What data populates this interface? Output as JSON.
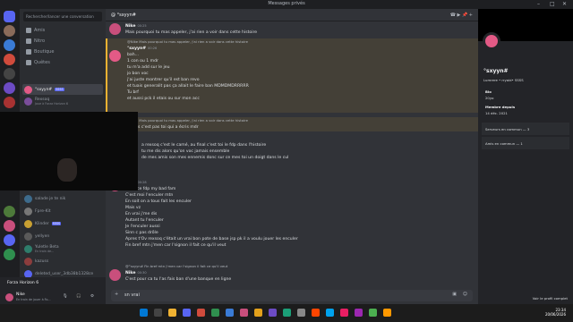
{
  "window": {
    "title": "Messages privés"
  },
  "sidebar": {
    "search_label": "Rechercher/lancer une conversation",
    "nav": [
      {
        "label": "Amis"
      },
      {
        "label": "Nitro"
      },
      {
        "label": "Boutique"
      },
      {
        "label": "Quêtes"
      }
    ],
    "section_title": "Messages privés",
    "dms": [
      {
        "name": "°sxyyn#",
        "tag": "SSSS",
        "sub": ""
      },
      {
        "name": "Rexsoq",
        "tag": "",
        "sub": "Joue à Forza Horizon 6"
      },
      {
        "name": "salade je te nik",
        "tag": "",
        "sub": ""
      },
      {
        "name": "Fpre-Kit",
        "tag": "",
        "sub": ""
      },
      {
        "name": "Klinder",
        "tag": "SSSS",
        "sub": ""
      },
      {
        "name": "yellyen",
        "tag": "",
        "sub": ""
      },
      {
        "name": "Yuletle Beta",
        "tag": "",
        "sub": "En train de..."
      },
      {
        "name": "kazuss",
        "tag": "",
        "sub": ""
      },
      {
        "name": "deleted_user_3db38b1328ce",
        "tag": "",
        "sub": ""
      }
    ],
    "game": "Forza Horizon 6",
    "user": {
      "name": "Nike",
      "status": "En train de jouer à Fo..."
    }
  },
  "chat": {
    "header_name": "°sxyyn#",
    "search_placeholder": "Rechercher à sxnnehe",
    "messages": [
      {
        "author": "Nike",
        "time": "00:25",
        "text": "Mais pourquoi tu mas appeler, j'ai rien a voir dans cette histoire",
        "reply": ""
      },
      {
        "author": "°sxyyn#",
        "time": "00:26",
        "text": "bah...",
        "reply": "@Nike Mais pourquoi tu mas appeler, j'ai rien a voir dans cette histoire"
      },
      {
        "author": "",
        "time": "",
        "text": "1 con ou 1 mdr",
        "reply": ""
      },
      {
        "author": "",
        "time": "",
        "text": "tu m'a add sur le jeu",
        "reply": ""
      },
      {
        "author": "",
        "time": "",
        "text": "jo bon voc",
        "reply": ""
      },
      {
        "author": "",
        "time": "",
        "text": "j'ai juste montrer qu'il est ban revo",
        "reply": ""
      },
      {
        "author": "",
        "time": "",
        "text": "et tuais generalit pas ça allait le faire ban MDMDMDRRRRR",
        "reply": ""
      },
      {
        "author": "",
        "time": "",
        "text": "Tu brf",
        "reply": ""
      },
      {
        "author": "",
        "time": "",
        "text": "et aussi pck il etais ou sur mon acc",
        "reply": ""
      },
      {
        "author": "°sxyyn#",
        "time": "00:27",
        "text": "je sais c'est pas toi qui a écris mdr",
        "reply": "@Nike Mais pourquoi tu mas appeler, j'ai rien a voir dans cette histoire"
      },
      {
        "author": "",
        "time": "",
        "text": "a rexsoq c'est le camé, au final c'est toi le fdp dans l'histoire",
        "reply": ""
      },
      {
        "author": "",
        "time": "",
        "text": "tu me dis alors qu'on voc jamais ensemble",
        "reply": ""
      },
      {
        "author": "",
        "time": "",
        "text": "de mes amis son mes ennemis donc sur ce mes toi un doigt dans le cul",
        "reply": ""
      },
      {
        "author": "Nike",
        "time": "00:28",
        "text": "C'est ce fdp my bad fam",
        "reply": ""
      },
      {
        "author": "",
        "time": "",
        "text": "C'est moi l'enculer mtn",
        "reply": ""
      },
      {
        "author": "",
        "time": "",
        "text": "En soit on a tous fait les enculer",
        "reply": ""
      },
      {
        "author": "",
        "time": "",
        "text": "Mais vz",
        "reply": ""
      },
      {
        "author": "",
        "time": "",
        "text": "En vrai j'me dis",
        "reply": ""
      },
      {
        "author": "",
        "time": "",
        "text": "Autant tu l'enculer",
        "reply": ""
      },
      {
        "author": "",
        "time": "",
        "text": "Je l'enculer aussi",
        "reply": ""
      },
      {
        "author": "",
        "time": "",
        "text": "Sinn c pas drôle",
        "reply": ""
      },
      {
        "author": "",
        "time": "",
        "text": "Apres t'Ov rexsoq c'était un vrai bon pote de base jsp pk il a voulu jouer les enculer",
        "reply": ""
      },
      {
        "author": "",
        "time": "",
        "text": "Fin bref mtn j'men car l'signon il fait ce qu'il veut",
        "reply": ""
      },
      {
        "author": "Nike",
        "time": "00:30",
        "text": "C'est pour ca tu l'as fais ban d'une banque en ligne",
        "reply": "@°sxyyn# Fin bref mtn j'men car l'signon il fait ce qu'il veut"
      }
    ],
    "composer_text": "sn vrai"
  },
  "profile": {
    "name": "°sxyyn#",
    "handle": "Lumrere • rryaid• SSSS",
    "bio_label": "Bio",
    "bio_value": "20yo",
    "member_label": "Membre depuis",
    "member_value": "14 déc. 2021",
    "servers": "Serveurs en commun — 3",
    "friends": "Amis en commun — 1",
    "full_profile": "Voir le profil complet"
  },
  "taskbar": {
    "time": "23:34",
    "date": "20/06/2026"
  },
  "colors": {
    "accent": "#5865f2",
    "mention_highlight": "#f0b232",
    "profile_avatar": "#e35a86"
  },
  "icons": [
    "home-icon",
    "friends-icon",
    "nitro-icon",
    "shop-icon",
    "quest-icon",
    "pin-icon",
    "call-icon",
    "video-icon",
    "inbox-icon",
    "help-icon",
    "mic-icon",
    "headphones-icon",
    "gear-icon",
    "gift-icon",
    "emoji-icon",
    "plus-icon"
  ]
}
